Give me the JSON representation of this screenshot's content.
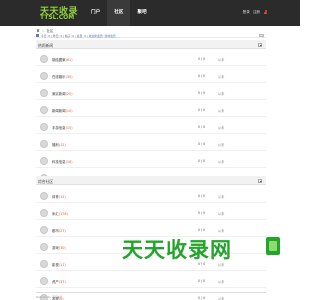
{
  "header": {
    "logo_main": "天天收录",
    "logo_sub": "TTSL.COM",
    "nav": [
      {
        "label": "门户",
        "active": false
      },
      {
        "label": "社区",
        "active": false
      },
      {
        "label": "聚吧",
        "active": false
      }
    ],
    "login": "登录",
    "register": "注册"
  },
  "breadcrumb": {
    "sep": ">",
    "current": "社区"
  },
  "info_bar": {
    "text": "今日: 0 | 昨日: 0 | 帖子: 0 | 会员: 0 | 欢迎新会员: 新的会员"
  },
  "sections": [
    {
      "title": "热闹新闻",
      "forums": [
        {
          "name": "钢结图案",
          "count": "(61)",
          "stat": "0 / 0",
          "last": "从未"
        },
        {
          "name": "在线娱乐",
          "count": "(35)",
          "stat": "0 / 0",
          "last": "从未"
        },
        {
          "name": "案实新闻",
          "count": "(25)",
          "stat": "0 / 0",
          "last": "从未"
        },
        {
          "name": "新闻新闻",
          "count": "(10)",
          "stat": "0 / 0",
          "last": "从未"
        },
        {
          "name": "手游信息",
          "count": "(15)",
          "stat": "0 / 0",
          "last": "从未"
        },
        {
          "name": "福利",
          "count": "(12)",
          "stat": "0 / 0",
          "last": "从未"
        },
        {
          "name": "科技信息",
          "count": "(18)",
          "stat": "0 / 0",
          "last": "从未"
        },
        {
          "name": "我们",
          "count": "(11)",
          "stat": "0 / 0",
          "last": "从未"
        }
      ]
    },
    {
      "title": "综合社区",
      "forums": [
        {
          "name": "体育",
          "count": "(15)",
          "stat": "0 / 0",
          "last": "从未"
        },
        {
          "name": "米汇",
          "count": "(178)",
          "stat": "0 / 0",
          "last": "从未"
        },
        {
          "name": "都市",
          "count": "(27)",
          "stat": "0 / 0",
          "last": "从未"
        },
        {
          "name": "游戏",
          "count": "(30)",
          "stat": "0 / 0",
          "last": "从未"
        },
        {
          "name": "影视",
          "count": "(17)",
          "stat": "0 / 0",
          "last": "从未"
        },
        {
          "name": "资产",
          "count": "(37)",
          "stat": "0 / 0",
          "last": "从未"
        },
        {
          "name": "发展",
          "count": "(0)",
          "stat": "0 / 0",
          "last": "从未"
        }
      ]
    }
  ],
  "footer": {
    "text": "Powered by 天天收录"
  },
  "watermark": {
    "text": "天天收录网"
  },
  "colors": {
    "accent": "#e05a28",
    "brand_green": "#22a52a",
    "header_bg": "#2b2b2b",
    "link_blue": "#4a6fa5"
  }
}
